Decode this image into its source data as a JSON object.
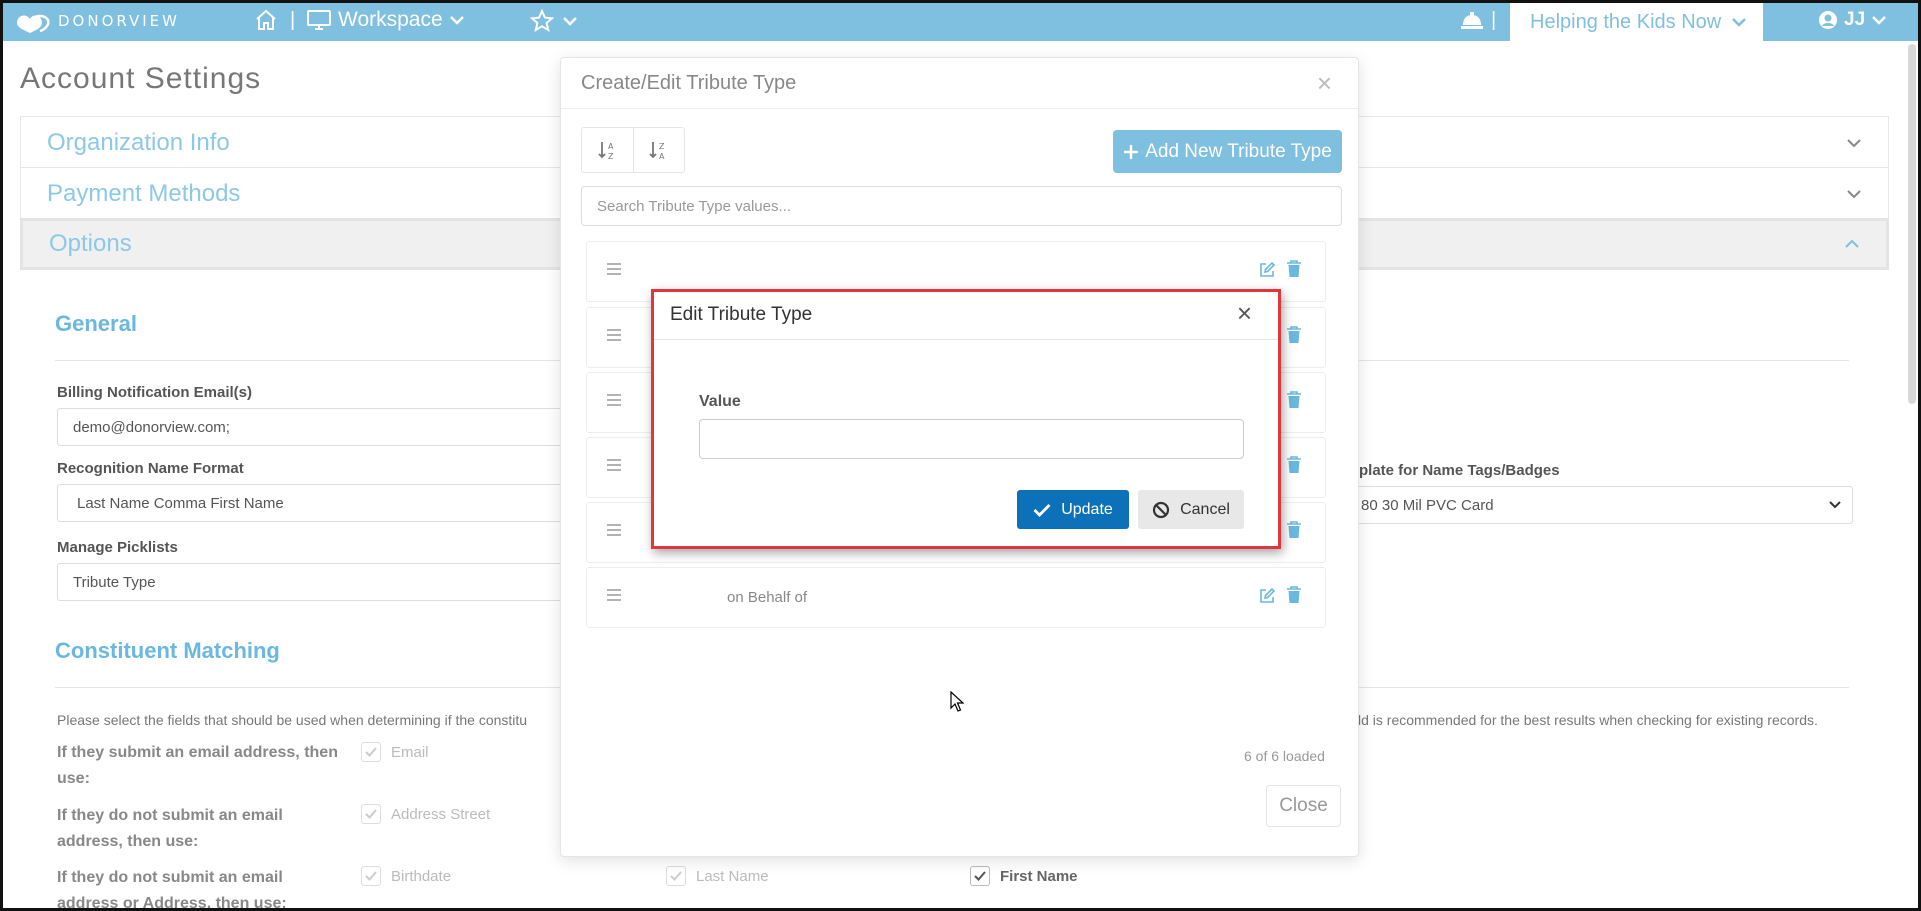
{
  "topbar": {
    "logo_text": "DONORVIEW",
    "workspace_label": "Workspace",
    "org_label": "Helping the Kids Now",
    "user_initials": "JJ"
  },
  "page": {
    "title": "Account Settings",
    "accordion": [
      "Organization Info",
      "Payment Methods",
      "Options"
    ],
    "general": {
      "title": "General",
      "billing_label": "Billing Notification Email(s)",
      "billing_value": "demo@donorview.com;",
      "recognition_label": "Recognition Name Format",
      "recognition_value": "Last Name Comma First Name",
      "template_label": "plate for Name Tags/Badges",
      "template_value": "80 30 Mil PVC Card",
      "picklist_label": "Manage Picklists",
      "picklist_value": "Tribute Type"
    },
    "matching": {
      "title": "Constituent Matching",
      "note_left": "Please select the fields that should be used when determining if the constitu",
      "note_right": "ld is recommended for the best results when checking for existing records.",
      "q1": "If they submit an email address, then use:",
      "q2": "If they do not submit an email address, then use:",
      "q3": "If they do not submit an email address or Address, then use:",
      "opt_email": "Email",
      "opt_address": "Address Street",
      "opt_birthdate": "Birthdate",
      "opt_lastname": "Last Name",
      "opt_firstname": "First Name"
    }
  },
  "modal_tribute": {
    "title": "Create/Edit Tribute Type",
    "add_label": "Add New Tribute Type",
    "search_placeholder": "Search Tribute Type values...",
    "last_row_value": "on Behalf of",
    "loaded_text": "6 of 6 loaded",
    "close_label": "Close"
  },
  "modal_edit": {
    "title": "Edit Tribute Type",
    "value_label": "Value",
    "value": "",
    "update_label": "Update",
    "cancel_label": "Cancel"
  },
  "colors": {
    "brand": "#7fbfdf",
    "primary_button": "#0d71b9",
    "highlight_border": "#e0363c"
  }
}
